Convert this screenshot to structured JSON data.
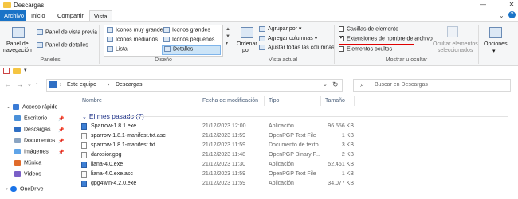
{
  "window": {
    "title": "Descargas",
    "icon": "folder-icon"
  },
  "tabs": [
    {
      "label": "Archivo"
    },
    {
      "label": "Inicio"
    },
    {
      "label": "Compartir"
    },
    {
      "label": "Vista"
    }
  ],
  "ribbon": {
    "panes": {
      "nav_pane_label_1": "Panel de",
      "nav_pane_label_2": "navegación",
      "preview_label": "Panel de vista previa",
      "details_label": "Panel de detalles",
      "group_label": "Paneles"
    },
    "layout": {
      "items": [
        "Iconos muy grandes",
        "Iconos grandes",
        "Iconos medianos",
        "Iconos pequeños",
        "Lista",
        "Detalles"
      ],
      "selected": "Detalles",
      "group_label": "Diseño"
    },
    "current_view": {
      "sort_label_1": "Ordenar",
      "sort_label_2": "por",
      "group_by": "Agrupar por",
      "add_columns": "Agregar columnas",
      "fit_columns": "Ajustar todas las columnas",
      "group_label": "Vista actual"
    },
    "show_hide": {
      "item_checkboxes": "Casillas de elemento",
      "item_checkboxes_checked": false,
      "file_extensions": "Extensiones de nombre de archivo",
      "file_extensions_checked": true,
      "hidden_items": "Elementos ocultos",
      "hidden_items_checked": false,
      "hide_selected_1": "Ocultar elementos",
      "hide_selected_2": "seleccionados",
      "group_label": "Mostrar u ocultar"
    },
    "options_label": "Opciones"
  },
  "address": {
    "breadcrumb": [
      "Este equipo",
      "Descargas"
    ],
    "search_placeholder": "Buscar en Descargas"
  },
  "nav_pane": {
    "items": [
      {
        "label": "Acceso rápido",
        "icon": "star-icon",
        "color": "#3a7bd5"
      },
      {
        "label": "Escritorio",
        "icon": "desktop-icon",
        "color": "#4a90d9"
      },
      {
        "label": "Descargas",
        "icon": "download-icon",
        "color": "#2f6fc4"
      },
      {
        "label": "Documentos",
        "icon": "documents-icon",
        "color": "#8aa4c2"
      },
      {
        "label": "Imágenes",
        "icon": "pictures-icon",
        "color": "#5fa4e8"
      },
      {
        "label": "Música",
        "icon": "music-icon",
        "color": "#e06b2a"
      },
      {
        "label": "Vídeos",
        "icon": "video-icon",
        "color": "#7a5fc7"
      },
      {
        "label": "OneDrive",
        "icon": "cloud-icon",
        "color": "#1a73e8"
      }
    ]
  },
  "list": {
    "columns": [
      "Nombre",
      "Fecha de modificación",
      "Tipo",
      "Tamaño"
    ],
    "group_title": "El mes pasado (7)",
    "rows": [
      {
        "name": "Sparrow-1.8.1.exe",
        "date": "21/12/2023 12:00",
        "type": "Aplicación",
        "size": "96.556 KB",
        "icon": "app-icon"
      },
      {
        "name": "sparrow-1.8.1-manifest.txt.asc",
        "date": "21/12/2023 11:59",
        "type": "OpenPGP Text File",
        "size": "1 KB",
        "icon": "pgp-file-icon"
      },
      {
        "name": "sparrow-1.8.1-manifest.txt",
        "date": "21/12/2023 11:59",
        "type": "Documento de texto",
        "size": "3 KB",
        "icon": "text-file-icon"
      },
      {
        "name": "darosior.gpg",
        "date": "21/12/2023 11:48",
        "type": "OpenPGP Binary F...",
        "size": "2 KB",
        "icon": "pgp-file-icon"
      },
      {
        "name": "liana-4.0.exe",
        "date": "21/12/2023 11:30",
        "type": "Aplicación",
        "size": "52.461 KB",
        "icon": "app-icon"
      },
      {
        "name": "liana-4.0.exe.asc",
        "date": "21/12/2023 11:59",
        "type": "OpenPGP Text File",
        "size": "1 KB",
        "icon": "pgp-file-icon"
      },
      {
        "name": "gpg4win-4.2.0.exe",
        "date": "21/12/2023 11:59",
        "type": "Aplicación",
        "size": "34.077 KB",
        "icon": "app-icon"
      }
    ]
  }
}
